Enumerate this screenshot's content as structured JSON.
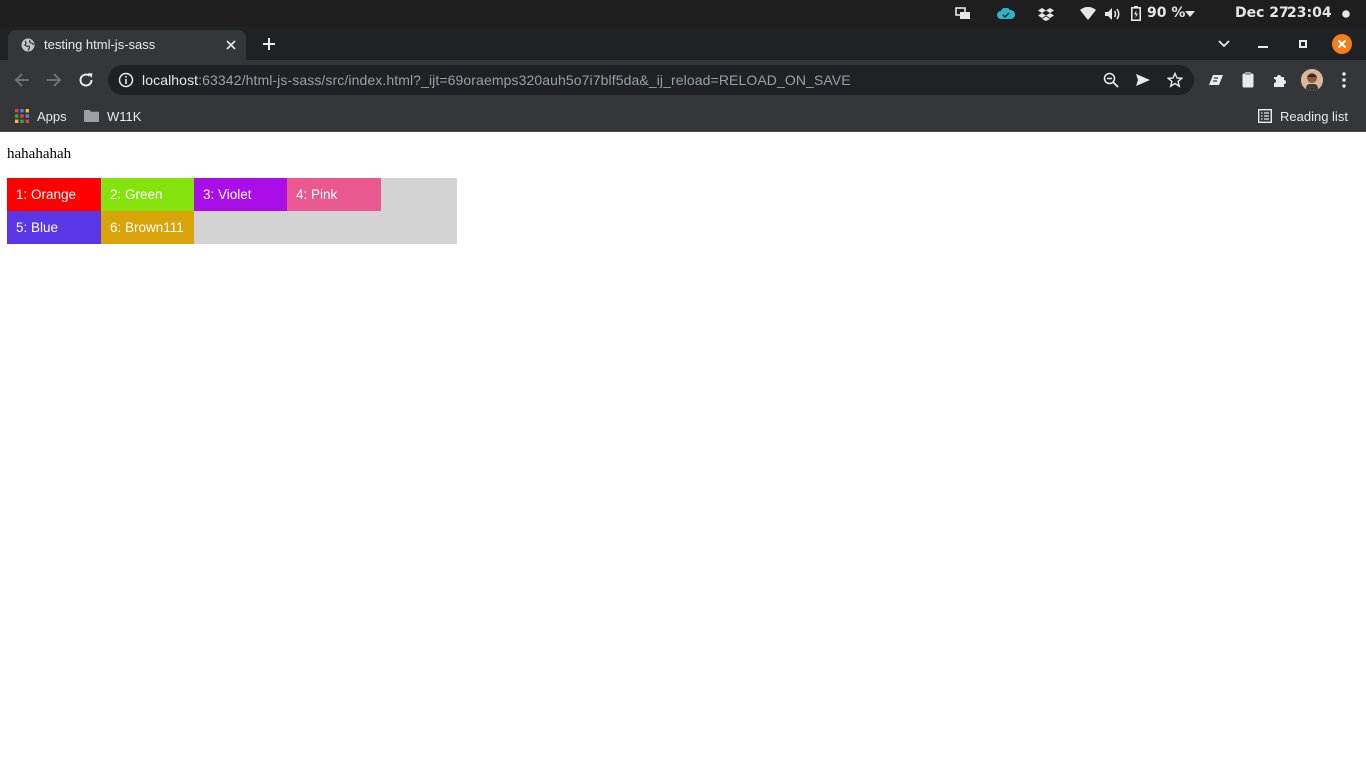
{
  "os_bar": {
    "battery_percent": "90 %",
    "date": "Dec 27",
    "time": "23:04",
    "colors": {
      "cloud": "#2cb5c8",
      "close_button": "#f47e1c"
    }
  },
  "tab": {
    "title": "testing html-js-sass"
  },
  "address_bar": {
    "host": "localhost",
    "rest": ":63342/html-js-sass/src/index.html?_ijt=69oraemps320auh5o7i7blf5da&_ij_reload=RELOAD_ON_SAVE"
  },
  "bookmarks": {
    "apps_label": "Apps",
    "folder_label": "W11K",
    "reading_list_label": "Reading list"
  },
  "page": {
    "text": "hahahahah",
    "container_color": "#d3d3d3",
    "boxes": [
      {
        "label": "1: Orange",
        "color": "#ff0000"
      },
      {
        "label": "2: Green",
        "color": "#84e30c"
      },
      {
        "label": "3: Violet",
        "color": "#a90de8"
      },
      {
        "label": "4: Pink",
        "color": "#e9588f"
      },
      {
        "label": "5: Blue",
        "color": "#5b36e6"
      },
      {
        "label": "6: Brown111",
        "color": "#d8a409"
      }
    ]
  }
}
